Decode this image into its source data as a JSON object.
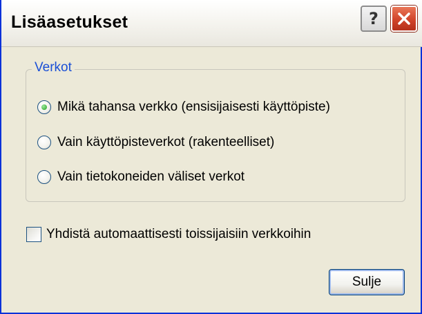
{
  "window": {
    "title": "Lisäasetukset",
    "help_glyph": "?",
    "accent_colors": {
      "frame": "#0831d9",
      "close_button": "#d1442a",
      "group_title": "#1a4fd6"
    }
  },
  "networks_group": {
    "title": "Verkot",
    "options": [
      {
        "label": "Mikä tahansa verkko (ensisijaisesti käyttöpiste)",
        "checked": true
      },
      {
        "label": "Vain käyttöpisteverkot (rakenteelliset)",
        "checked": false
      },
      {
        "label": "Vain tietokoneiden väliset verkot",
        "checked": false
      }
    ]
  },
  "auto_connect": {
    "label": "Yhdistä automaattisesti toissijaisiin verkkoihin",
    "checked": false
  },
  "buttons": {
    "close_label": "Sulje"
  }
}
